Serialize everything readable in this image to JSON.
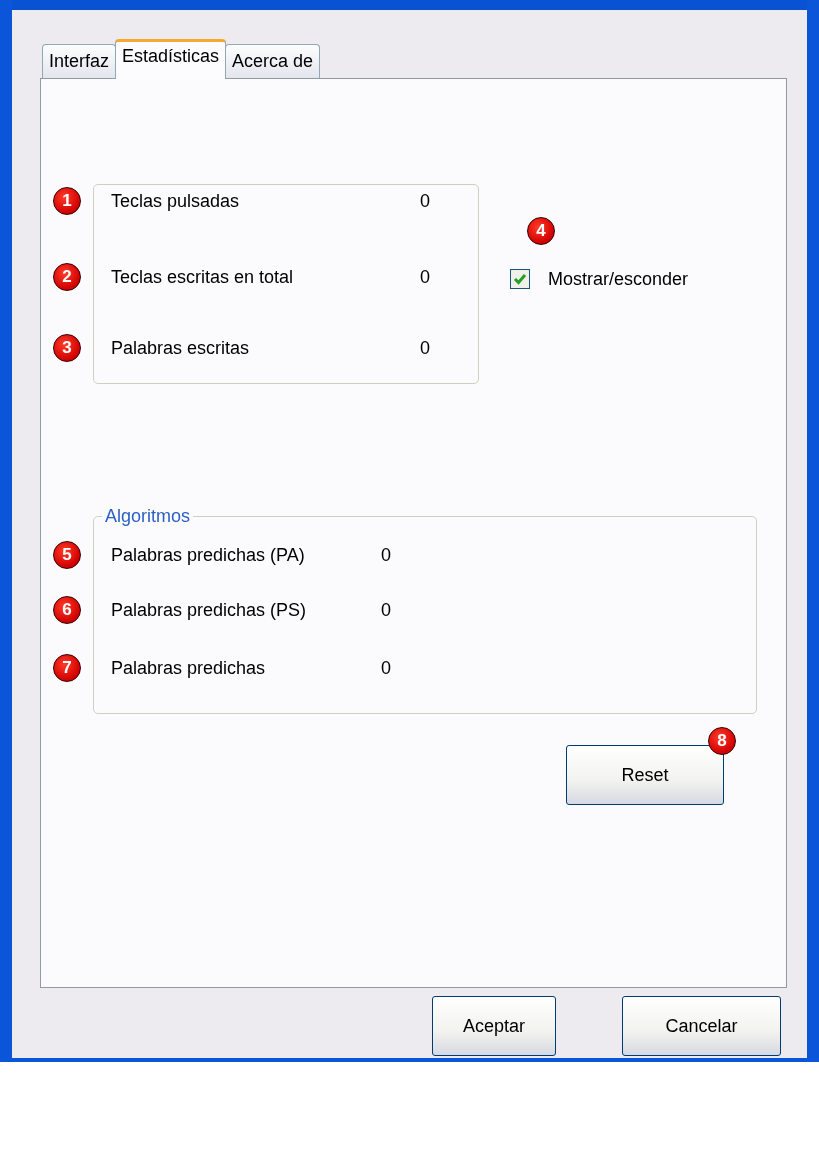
{
  "tabs": [
    {
      "label": "Interfaz",
      "selected": false
    },
    {
      "label": "Estadísticas",
      "selected": true
    },
    {
      "label": "Acerca de",
      "selected": false
    }
  ],
  "stats": {
    "rows": [
      {
        "badge": "1",
        "label": "Teclas pulsadas",
        "value": "0"
      },
      {
        "badge": "2",
        "label": "Teclas escritas en total",
        "value": "0"
      },
      {
        "badge": "3",
        "label": "Palabras escritas",
        "value": "0"
      }
    ]
  },
  "show_hide": {
    "badge": "4",
    "label": "Mostrar/esconder",
    "checked": true
  },
  "algorithms": {
    "legend": "Algoritmos",
    "rows": [
      {
        "badge": "5",
        "label": "Palabras predichas (PA)",
        "value": "0"
      },
      {
        "badge": "6",
        "label": "Palabras predichas (PS)",
        "value": "0"
      },
      {
        "badge": "7",
        "label": "Palabras predichas",
        "value": "0"
      }
    ]
  },
  "reset_button": {
    "label": "Reset",
    "badge": "8"
  },
  "buttons": [
    "Aceptar",
    "Cancelar"
  ]
}
